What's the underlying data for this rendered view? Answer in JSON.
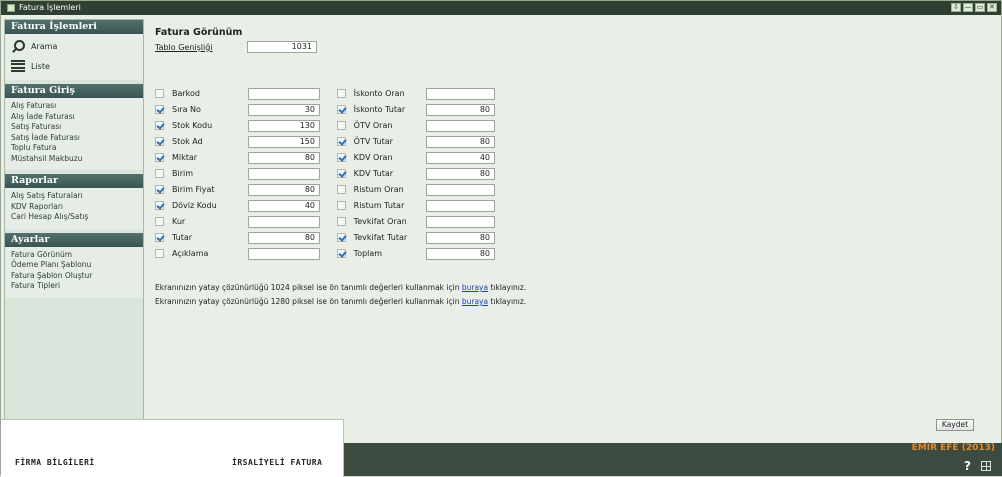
{
  "window": {
    "title": "Fatura İşlemleri"
  },
  "window_buttons": [
    "⇩",
    "—",
    "▭",
    "✕"
  ],
  "sidebar": {
    "panels": [
      {
        "header": "Fatura İşlemleri",
        "items": [
          "Arama",
          "Liste"
        ]
      },
      {
        "header": "Fatura Giriş",
        "items": [
          "Alış Faturası",
          "Alış İade Faturası",
          "Satış Faturası",
          "Satış İade Faturası",
          "Toplu Fatura",
          "Müstahsil Makbuzu"
        ]
      },
      {
        "header": "Raporlar",
        "items": [
          "Alış Satış Faturaları",
          "KDV Raporları",
          "Cari Hesap Alış/Satış"
        ]
      },
      {
        "header": "Ayarlar",
        "items": [
          "Fatura Görünüm",
          "Ödeme Planı Şablonu",
          "Fatura Şablon Oluştur",
          "Fatura Tipleri"
        ]
      }
    ]
  },
  "main": {
    "title": "Fatura Görünüm",
    "table_width": {
      "label": "Tablo Genişliği",
      "value": "1031"
    },
    "fields_left": [
      {
        "label": "Barkod",
        "checked": false,
        "value": ""
      },
      {
        "label": "Sıra No",
        "checked": true,
        "value": "30"
      },
      {
        "label": "Stok Kodu",
        "checked": true,
        "value": "130"
      },
      {
        "label": "Stok Ad",
        "checked": true,
        "value": "150"
      },
      {
        "label": "Miktar",
        "checked": true,
        "value": "80"
      },
      {
        "label": "Birim",
        "checked": false,
        "value": ""
      },
      {
        "label": "Birim Fiyat",
        "checked": true,
        "value": "80"
      },
      {
        "label": "Döviz Kodu",
        "checked": true,
        "value": "40"
      },
      {
        "label": "Kur",
        "checked": false,
        "value": ""
      },
      {
        "label": "Tutar",
        "checked": true,
        "value": "80"
      },
      {
        "label": "Açıklama",
        "checked": false,
        "value": ""
      }
    ],
    "fields_right": [
      {
        "label": "İskonto Oran",
        "checked": false,
        "value": ""
      },
      {
        "label": "İskonto Tutar",
        "checked": true,
        "value": "80"
      },
      {
        "label": "ÖTV Oran",
        "checked": false,
        "value": ""
      },
      {
        "label": "ÖTV Tutar",
        "checked": true,
        "value": "80"
      },
      {
        "label": "KDV Oran",
        "checked": true,
        "value": "40"
      },
      {
        "label": "KDV Tutar",
        "checked": true,
        "value": "80"
      },
      {
        "label": "Ristum Oran",
        "checked": false,
        "value": ""
      },
      {
        "label": "Ristum Tutar",
        "checked": false,
        "value": ""
      },
      {
        "label": "Tevkifat Oran",
        "checked": false,
        "value": ""
      },
      {
        "label": "Tevkifat Tutar",
        "checked": true,
        "value": "80"
      },
      {
        "label": "Toplam",
        "checked": true,
        "value": "80"
      }
    ],
    "notes": [
      {
        "before": "Ekranınızın yatay çözünürlüğü 1024 piksel ise ön tanımlı değerleri kullanmak için ",
        "link": "buraya",
        "after": " tıklayınız."
      },
      {
        "before": "Ekranınızın yatay çözünürlüğü 1280 piksel ise ön tanımlı değerleri kullanmak için ",
        "link": "buraya",
        "after": " tıklayınız."
      }
    ],
    "save_label": "Kaydet"
  },
  "brand": "EMİR EFE (2013)",
  "preview": {
    "firm_label": "FİRMA BİLGİLERİ",
    "doc_type": "İRSALİYELİ FATURA"
  },
  "colors": {
    "header_bg": "#2f3f33",
    "panel_header": "#3a5553",
    "accent_brand": "#e18a2b",
    "link": "#1b3fbf"
  }
}
